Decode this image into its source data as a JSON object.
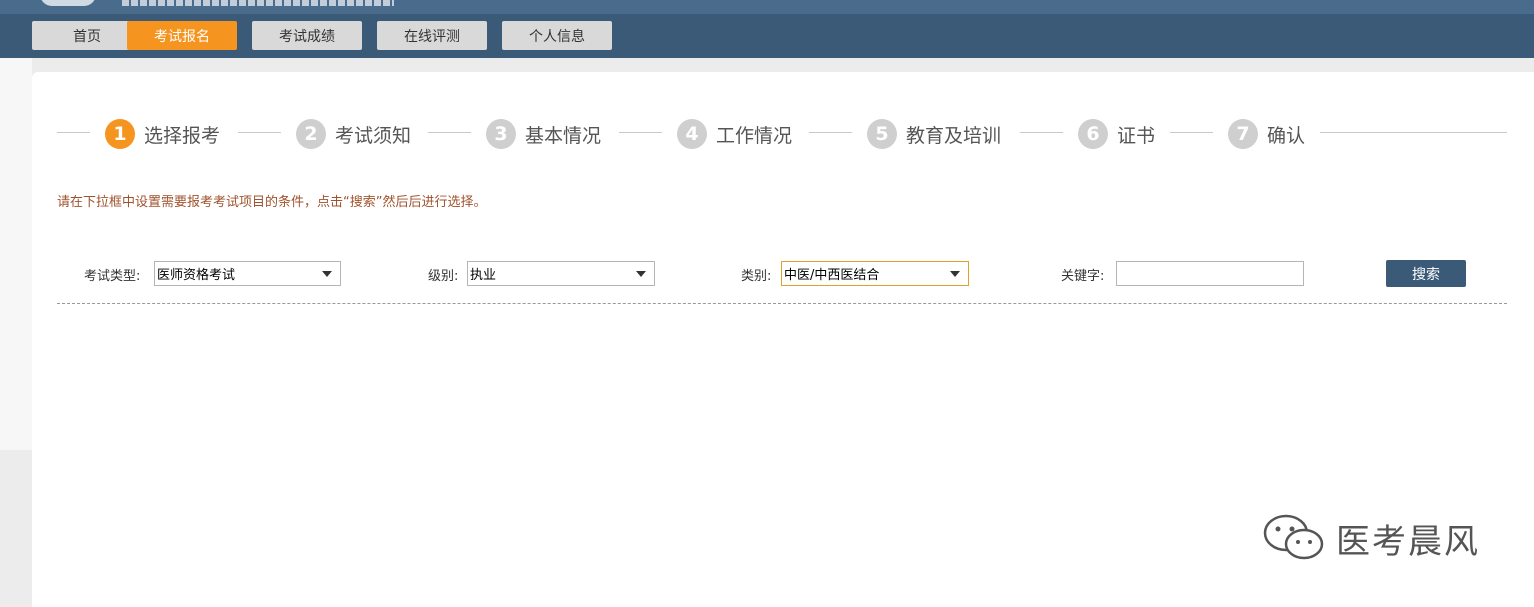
{
  "nav": {
    "items": [
      "首页",
      "考试报名",
      "考试成绩",
      "在线评测",
      "个人信息"
    ],
    "active_index": 1
  },
  "steps": [
    {
      "num": "1",
      "label": "选择报考"
    },
    {
      "num": "2",
      "label": "考试须知"
    },
    {
      "num": "3",
      "label": "基本情况"
    },
    {
      "num": "4",
      "label": "工作情况"
    },
    {
      "num": "5",
      "label": "教育及培训"
    },
    {
      "num": "6",
      "label": "证书"
    },
    {
      "num": "7",
      "label": "确认"
    }
  ],
  "active_step": 0,
  "hint": "请在下拉框中设置需要报考考试项目的条件，点击“搜索”然后后进行选择。",
  "filters": {
    "exam_type": {
      "label": "考试类型:",
      "value": "医师资格考试"
    },
    "level": {
      "label": "级别:",
      "value": "执业"
    },
    "category": {
      "label": "类别:",
      "value": "中医/中西医结合"
    },
    "keyword": {
      "label": "关键字:",
      "value": ""
    }
  },
  "search_label": "搜索",
  "watermark": "医考晨风",
  "colors": {
    "accent": "#f5941e",
    "nav": "#3b5a78",
    "hint": "#a0522d"
  }
}
